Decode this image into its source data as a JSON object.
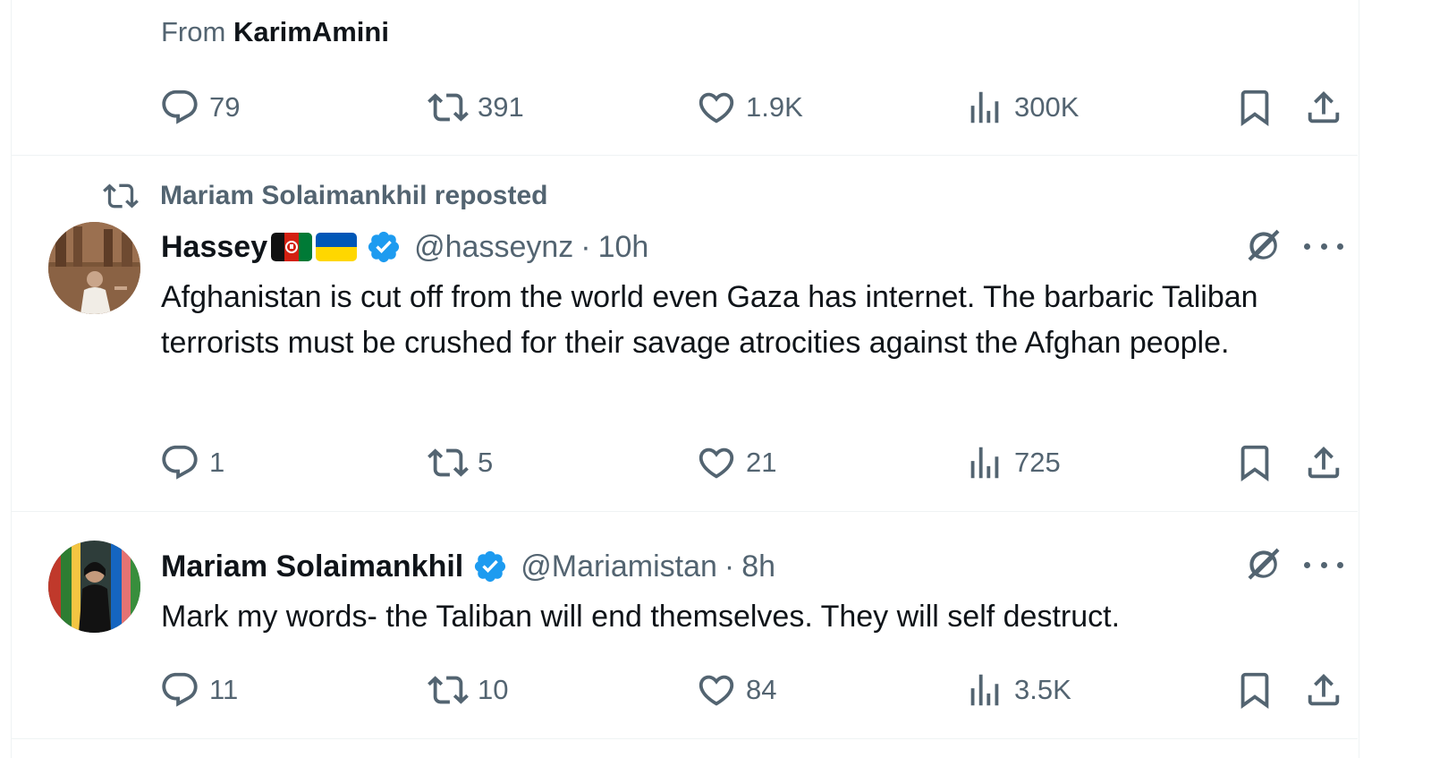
{
  "tweet0": {
    "from_prefix": "From",
    "from_user": "KarimAmini",
    "replies": "79",
    "reposts": "391",
    "likes": "1.9K",
    "views": "300K"
  },
  "tweet1": {
    "repost_label": "Mariam Solaimankhil reposted",
    "name": "Hassey",
    "handle": "@hasseynz",
    "sep": "·",
    "time": "10h",
    "text": "Afghanistan is cut off from the world even Gaza has internet. The barbaric Taliban terrorists must be crushed for their savage atrocities against the Afghan people.",
    "replies": "1",
    "reposts": "5",
    "likes": "21",
    "views": "725"
  },
  "tweet2": {
    "name": "Mariam Solaimankhil",
    "handle": "@Mariamistan",
    "sep": "·",
    "time": "8h",
    "text": "Mark my words- the Taliban will end themselves. They will self destruct.",
    "replies": "11",
    "reposts": "10",
    "likes": "84",
    "views": "3.5K"
  },
  "colors": {
    "text": "#0f1419",
    "muted": "#536471",
    "verified": "#1d9bf0",
    "border": "#eff3f4"
  },
  "icons": [
    "reply-icon",
    "repost-icon",
    "like-icon",
    "views-icon",
    "bookmark-icon",
    "share-icon",
    "grok-icon",
    "more-icon",
    "verified-badge-icon"
  ]
}
